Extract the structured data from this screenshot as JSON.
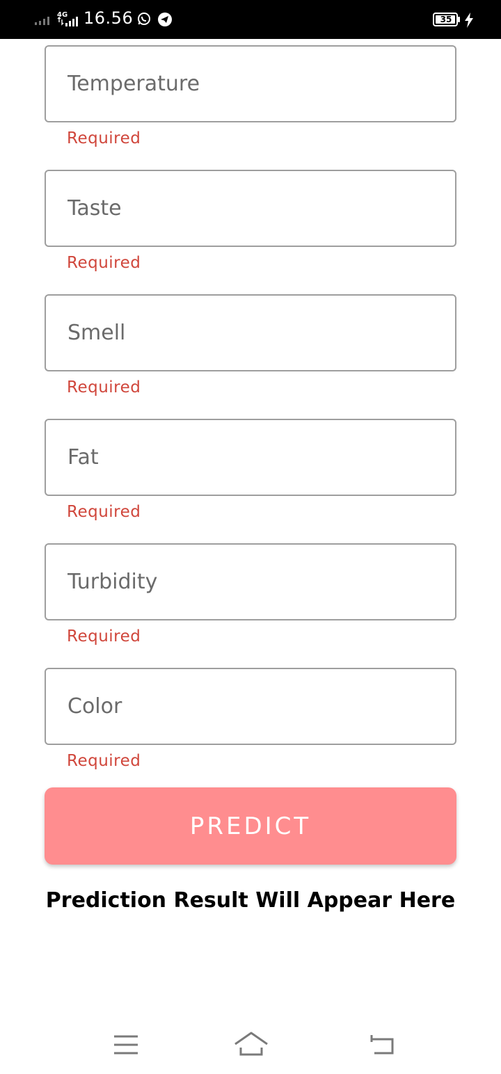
{
  "status_bar": {
    "time": "16.56",
    "network": "4G",
    "battery": "35",
    "icons": [
      "signal-icon",
      "4g-signal-icon",
      "whatsapp-icon",
      "telegram-icon",
      "battery-icon",
      "charging-icon"
    ]
  },
  "form": {
    "fields": [
      {
        "placeholder": "Temperature",
        "value": "",
        "error": "Required"
      },
      {
        "placeholder": "Taste",
        "value": "",
        "error": "Required"
      },
      {
        "placeholder": "Smell",
        "value": "",
        "error": "Required"
      },
      {
        "placeholder": "Fat",
        "value": "",
        "error": "Required"
      },
      {
        "placeholder": "Turbidity",
        "value": "",
        "error": "Required"
      },
      {
        "placeholder": "Color",
        "value": "",
        "error": "Required"
      }
    ],
    "predict_label": "PREDICT",
    "result_text": "Prediction Result Will Appear Here"
  },
  "nav_bar": {
    "icons": [
      "menu-icon",
      "home-icon",
      "back-icon"
    ]
  },
  "colors": {
    "status_bar_bg": "#000000",
    "error": "#d0463b",
    "button": "#ff8d8f",
    "input_border": "#9e9e9e"
  }
}
